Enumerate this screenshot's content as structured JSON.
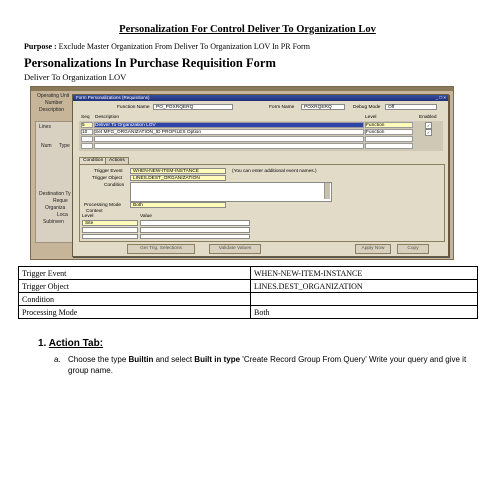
{
  "doc": {
    "title": "Personalization For Control Deliver To Organization Lov",
    "purpose_label": "Purpose :",
    "purpose_text": " Exclude Master Organization From Deliver To Organization LOV In PR Form",
    "heading": "Personalizations In Purchase Requisition Form",
    "subheading": "Deliver To Organization LOV"
  },
  "shot": {
    "bg_labels": [
      "Operating Unit",
      "Number",
      "Description",
      "Lines",
      "Num",
      "Type",
      "Destination Ty",
      "Reque",
      "Organiza",
      "Loca",
      "Subinven"
    ],
    "window_title": "Form Personalizations (Requisitions)",
    "window_buttons": "_ □ ×",
    "function_name_label": "Function Name",
    "function_name_value": "PO_POXRQERQ",
    "form_name_label": "Form Name",
    "form_name_value": "POXRQERQ",
    "debug_mode_label": "Debug Mode",
    "debug_mode_value": "Off",
    "grid_headers": [
      "Seq",
      "Description",
      "Level",
      "Enabled"
    ],
    "rows": [
      {
        "seq": "5",
        "desc": "Deliver To Organization LOV",
        "level": "Function",
        "enabled": "✓"
      },
      {
        "seq": "10",
        "desc": "Set MFG_ORGANIZATION_ID PROFILES Option",
        "level": "Function",
        "enabled": "✓"
      }
    ],
    "tabs": [
      "Condition",
      "Actions"
    ],
    "trigger_event_label": "Trigger Event",
    "trigger_event_value": "WHEN-NEW-ITEM-INSTANCE",
    "trigger_hint": "(You can enter additional event names.)",
    "trigger_object_label": "Trigger Object",
    "trigger_object_value": "LINES.DEST_ORGANIZATION",
    "condition_label": "Condition",
    "processing_mode_label": "Processing Mode",
    "processing_mode_value": "Both",
    "context_label": "Context",
    "level_header": "Level",
    "value_header": "Value",
    "level_value": "Site",
    "buttons": [
      "Get Trig. Selections",
      "Validate Values",
      "Apply Now",
      "Copy"
    ]
  },
  "table": [
    {
      "label": "Trigger Event",
      "value": "WHEN-NEW-ITEM-INSTANCE"
    },
    {
      "label": "Trigger Object",
      "value": "LINES.DEST_ORGANIZATION"
    },
    {
      "label": "Condition",
      "value": ""
    },
    {
      "label": "Processing Mode",
      "value": "Both"
    }
  ],
  "action": {
    "number": "1.",
    "title": "Action Tab:",
    "item_letter": "a.",
    "text_1": "Choose the type ",
    "bold_1": "Builtin",
    "text_2": " and select ",
    "bold_2": "Built in type",
    "text_3": " 'Create Record Group From Query' Write your query and give it group name."
  }
}
